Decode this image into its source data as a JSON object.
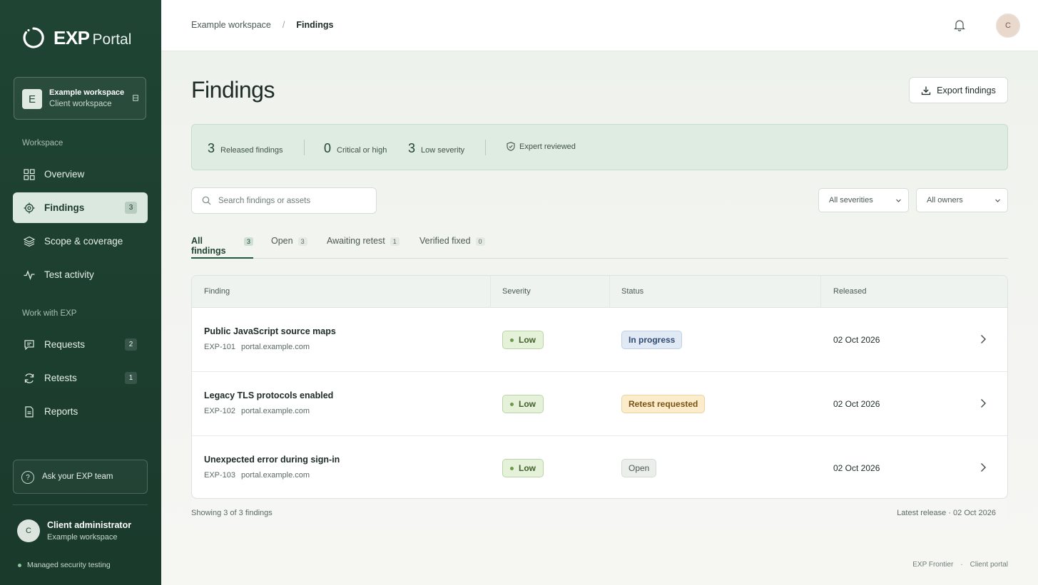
{
  "brand": {
    "name_bold": "EXP",
    "name_light": "Portal"
  },
  "workspace_card": {
    "initial": "E",
    "name": "Example workspace",
    "subtitle": "Client workspace"
  },
  "sidebar": {
    "section_workspace": "Workspace",
    "section_work": "Work with EXP",
    "items": [
      {
        "label": "Overview",
        "icon": "grid-icon"
      },
      {
        "label": "Findings",
        "icon": "target-icon",
        "count": "3",
        "active": true
      },
      {
        "label": "Scope & coverage",
        "icon": "layers-icon"
      },
      {
        "label": "Test activity",
        "icon": "activity-icon"
      },
      {
        "label": "Requests",
        "icon": "message-icon",
        "count": "2"
      },
      {
        "label": "Retests",
        "icon": "refresh-icon",
        "count": "1"
      },
      {
        "label": "Reports",
        "icon": "document-icon"
      }
    ],
    "ask_label": "Ask your EXP team",
    "user": {
      "initial": "C",
      "name": "Client administrator",
      "workspace": "Example workspace"
    },
    "footer_note": "Managed security testing"
  },
  "topbar": {
    "breadcrumb": [
      "Example workspace",
      "Findings"
    ],
    "separator": "/",
    "avatar_initial": "C"
  },
  "page": {
    "title": "Findings",
    "export_label": "Export findings"
  },
  "stats": [
    {
      "value": "3",
      "label": "Released findings"
    },
    {
      "value": "0",
      "label": "Critical or high"
    },
    {
      "value": "3",
      "label": "Low severity"
    }
  ],
  "reviewed_label": "Expert reviewed",
  "search": {
    "placeholder": "Search findings or assets",
    "value": ""
  },
  "filters": {
    "severity": "All severities",
    "owner": "All owners"
  },
  "tabs": [
    {
      "label": "All findings",
      "count": "3",
      "active": true
    },
    {
      "label": "Open",
      "count": "3"
    },
    {
      "label": "Awaiting retest",
      "count": "1"
    },
    {
      "label": "Verified fixed",
      "count": "0"
    }
  ],
  "table": {
    "columns": [
      "Finding",
      "Severity",
      "Status",
      "Released"
    ],
    "rows": [
      {
        "title": "Public JavaScript source maps",
        "id": "EXP-101",
        "asset": "portal.example.com",
        "severity": "Low",
        "status": "In progress",
        "released": "02 Oct 2026"
      },
      {
        "title": "Legacy TLS protocols enabled",
        "id": "EXP-102",
        "asset": "portal.example.com",
        "severity": "Low",
        "status": "Retest requested",
        "released": "02 Oct 2026"
      },
      {
        "title": "Unexpected error during sign-in",
        "id": "EXP-103",
        "asset": "portal.example.com",
        "severity": "Low",
        "status": "Open",
        "released": "02 Oct 2026"
      }
    ],
    "footer_left": "Showing 3 of 3 findings",
    "footer_right": "Latest release · 02 Oct 2026"
  },
  "page_footer": {
    "left": "EXP Frontier",
    "sep": "·",
    "right": "Client portal"
  },
  "colors": {
    "sidebar": "#1f4433",
    "accent": "#1f5a3e",
    "low": "#e6f1d9",
    "in_progress": "#e1e9f4",
    "retest": "#fbeccb"
  }
}
